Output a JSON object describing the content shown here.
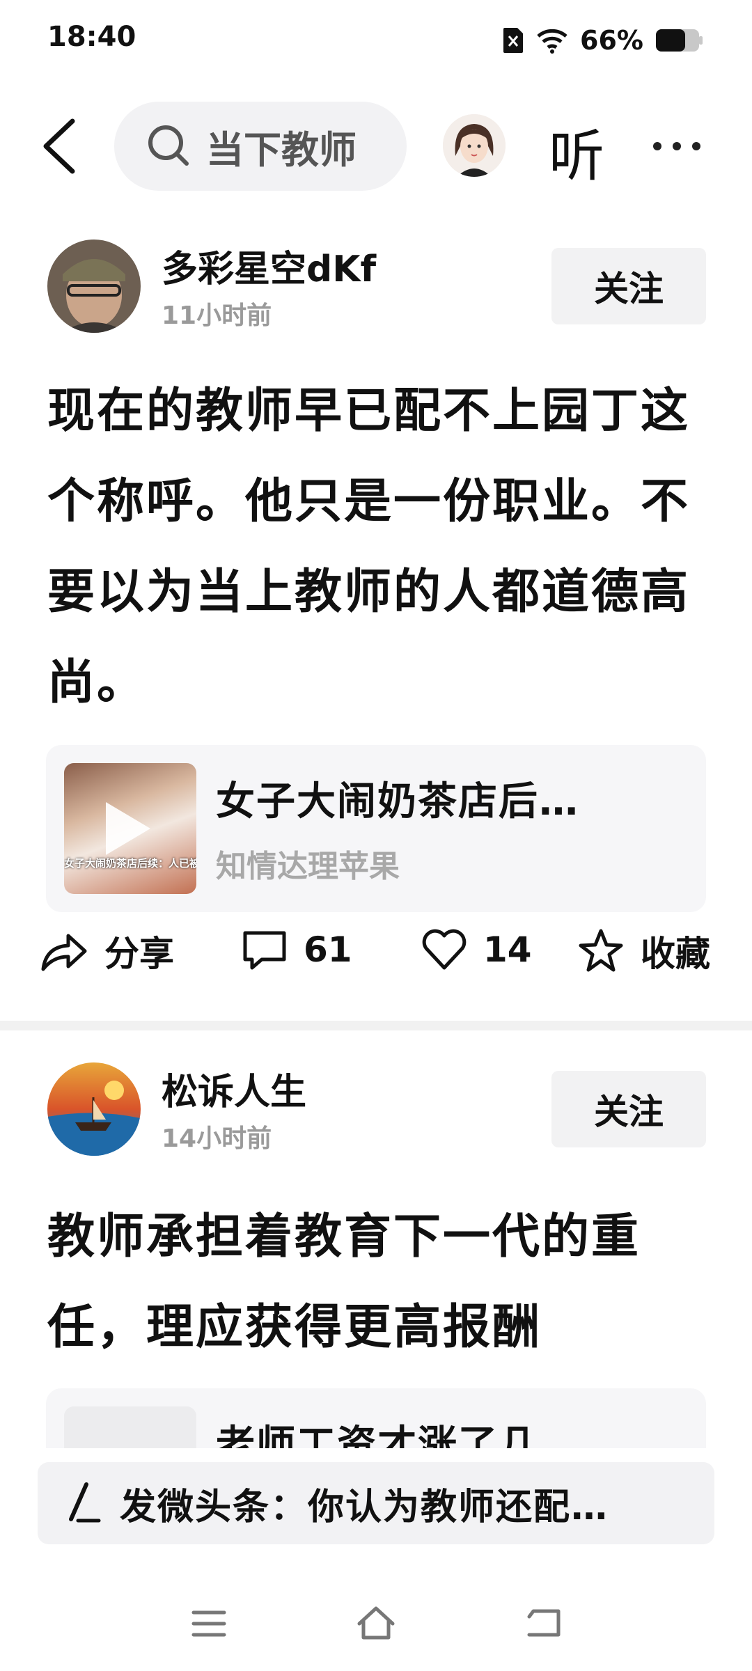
{
  "status_bar": {
    "time": "18:40",
    "battery": "66%"
  },
  "top_bar": {
    "search_text": "当下教师",
    "listen_label": "听"
  },
  "posts": [
    {
      "author": "多彩星空dKf",
      "time": "11小时前",
      "follow_label": "关注",
      "body": "现在的教师早已配不上园丁这个称呼。他只是一份职业。不要以为当上教师的人都道德高尚。",
      "card": {
        "title": "女子大闹奶茶店后…",
        "source": "知情达理苹果",
        "thumb_caption": "女子大闹奶茶店后续：人已被扒证件曝光彻底社死，职业"
      },
      "actions": {
        "share": "分享",
        "comments": "61",
        "likes": "14",
        "favorite": "收藏"
      }
    },
    {
      "author": "松诉人生",
      "time": "14小时前",
      "follow_label": "关注",
      "body": "教师承担着教育下一代的重任，理应获得更高报酬",
      "card": {
        "title": "老师工资才涨了几…"
      }
    }
  ],
  "compose": {
    "text": "发微头条：你认为教师还配…"
  },
  "colors": {
    "follow_bg": "#f2f2f3",
    "card_bg": "#f6f6f8",
    "muted": "#9a9a9a"
  }
}
